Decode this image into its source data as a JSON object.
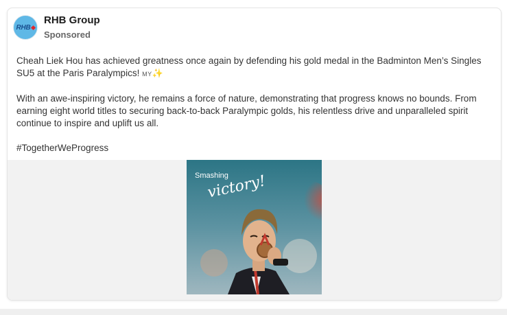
{
  "post": {
    "author": "RHB Group",
    "avatar_text": "RHB",
    "label": "Sponsored",
    "paragraph1": "Cheah Liek Hou has achieved greatness once again by defending his gold medal in the Badminton Men’s Singles SU5 at the Paris Paralympics!",
    "flag_text": "MY",
    "sparkle": "✨",
    "paragraph2": "With an awe-inspiring victory, he remains a force of nature, demonstrating that progress knows no bounds. From earning eight world titles to securing back-to-back Paralympic golds, his relentless drive and unparalleled spirit continue to inspire and uplift us all.",
    "hashtag": "#TogetherWeProgress"
  },
  "image": {
    "title_line1": "Smashing",
    "title_line2": "victory!"
  },
  "colors": {
    "avatar_bg": "#5fb8e6",
    "avatar_text": "#1a4f8f",
    "avatar_accent": "#e0262b",
    "media_bg": "#f2f2f2"
  }
}
